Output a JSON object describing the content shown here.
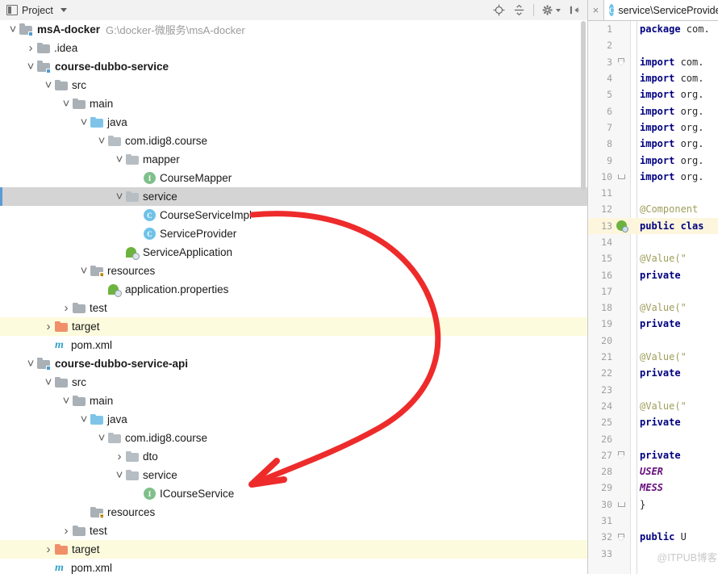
{
  "toolbar": {
    "title": "Project",
    "dropdown_caret": "chevron-down",
    "icons": [
      {
        "name": "locate-icon",
        "glyph": "target"
      },
      {
        "name": "collapse-all-icon",
        "glyph": "collapse"
      },
      {
        "name": "settings-icon",
        "glyph": "gear"
      },
      {
        "name": "hide-panel-icon",
        "glyph": "hide"
      }
    ]
  },
  "tree": {
    "rows": [
      {
        "indent": 0,
        "arrow": "v",
        "icon": "module-folder",
        "label": "msA-docker",
        "bold": true,
        "path": "G:\\docker-微服务\\msA-docker",
        "state": "normal"
      },
      {
        "indent": 1,
        "arrow": ">",
        "icon": "folder-gray",
        "label": ".idea",
        "bold": false,
        "path": "",
        "state": "normal"
      },
      {
        "indent": 1,
        "arrow": "v",
        "icon": "module-folder",
        "label": "course-dubbo-service",
        "bold": true,
        "path": "",
        "state": "normal"
      },
      {
        "indent": 2,
        "arrow": "v",
        "icon": "folder-gray",
        "label": "src",
        "bold": false,
        "path": "",
        "state": "normal"
      },
      {
        "indent": 3,
        "arrow": "v",
        "icon": "folder-gray",
        "label": "main",
        "bold": false,
        "path": "",
        "state": "normal"
      },
      {
        "indent": 4,
        "arrow": "v",
        "icon": "folder-blue",
        "label": "java",
        "bold": false,
        "path": "",
        "state": "normal"
      },
      {
        "indent": 5,
        "arrow": "v",
        "icon": "folder-package",
        "label": "com.idig8.course",
        "bold": false,
        "path": "",
        "state": "normal"
      },
      {
        "indent": 6,
        "arrow": "v",
        "icon": "folder-package",
        "label": "mapper",
        "bold": false,
        "path": "",
        "state": "normal"
      },
      {
        "indent": 7,
        "arrow": "",
        "icon": "interface-icon",
        "label": "CourseMapper",
        "bold": false,
        "path": "",
        "state": "normal"
      },
      {
        "indent": 6,
        "arrow": "v",
        "icon": "folder-package",
        "label": "service",
        "bold": false,
        "path": "",
        "state": "selected"
      },
      {
        "indent": 7,
        "arrow": "",
        "icon": "class-icon",
        "label": "CourseServiceImpl",
        "bold": false,
        "path": "",
        "state": "normal"
      },
      {
        "indent": 7,
        "arrow": "",
        "icon": "class-icon",
        "label": "ServiceProvider",
        "bold": false,
        "path": "",
        "state": "normal"
      },
      {
        "indent": 6,
        "arrow": "",
        "icon": "springboot-icon",
        "label": "ServiceApplication",
        "bold": false,
        "path": "",
        "state": "normal"
      },
      {
        "indent": 4,
        "arrow": "v",
        "icon": "folder-resources",
        "label": "resources",
        "bold": false,
        "path": "",
        "state": "normal"
      },
      {
        "indent": 5,
        "arrow": "",
        "icon": "springboot-icon",
        "label": "application.properties",
        "bold": false,
        "path": "",
        "state": "normal"
      },
      {
        "indent": 3,
        "arrow": ">",
        "icon": "folder-gray",
        "label": "test",
        "bold": false,
        "path": "",
        "state": "normal"
      },
      {
        "indent": 2,
        "arrow": ">",
        "icon": "folder-orange",
        "label": "target",
        "bold": false,
        "path": "",
        "state": "excluded"
      },
      {
        "indent": 2,
        "arrow": "",
        "icon": "maven-file-icon",
        "label": "pom.xml",
        "bold": false,
        "path": "",
        "state": "normal"
      },
      {
        "indent": 1,
        "arrow": "v",
        "icon": "module-folder",
        "label": "course-dubbo-service-api",
        "bold": true,
        "path": "",
        "state": "normal"
      },
      {
        "indent": 2,
        "arrow": "v",
        "icon": "folder-gray",
        "label": "src",
        "bold": false,
        "path": "",
        "state": "normal"
      },
      {
        "indent": 3,
        "arrow": "v",
        "icon": "folder-gray",
        "label": "main",
        "bold": false,
        "path": "",
        "state": "normal"
      },
      {
        "indent": 4,
        "arrow": "v",
        "icon": "folder-blue",
        "label": "java",
        "bold": false,
        "path": "",
        "state": "normal"
      },
      {
        "indent": 5,
        "arrow": "v",
        "icon": "folder-package",
        "label": "com.idig8.course",
        "bold": false,
        "path": "",
        "state": "normal"
      },
      {
        "indent": 6,
        "arrow": ">",
        "icon": "folder-package",
        "label": "dto",
        "bold": false,
        "path": "",
        "state": "normal"
      },
      {
        "indent": 6,
        "arrow": "v",
        "icon": "folder-package",
        "label": "service",
        "bold": false,
        "path": "",
        "state": "normal"
      },
      {
        "indent": 7,
        "arrow": "",
        "icon": "interface-icon",
        "label": "ICourseService",
        "bold": false,
        "path": "",
        "state": "normal"
      },
      {
        "indent": 4,
        "arrow": "",
        "icon": "folder-resources",
        "label": "resources",
        "bold": false,
        "path": "",
        "state": "normal"
      },
      {
        "indent": 3,
        "arrow": ">",
        "icon": "folder-gray",
        "label": "test",
        "bold": false,
        "path": "",
        "state": "normal"
      },
      {
        "indent": 2,
        "arrow": ">",
        "icon": "folder-orange",
        "label": "target",
        "bold": false,
        "path": "",
        "state": "excluded"
      },
      {
        "indent": 2,
        "arrow": "",
        "icon": "maven-file-icon",
        "label": "pom.xml",
        "bold": false,
        "path": "",
        "state": "normal"
      }
    ]
  },
  "editor": {
    "tab": {
      "label": "service\\ServiceProvider",
      "icon": "class-icon",
      "close_glyph": "×"
    },
    "watermark": "@ITPUB博客",
    "lines": [
      {
        "n": "1",
        "gutter": "",
        "hl": false,
        "tokens": [
          {
            "t": "package",
            "c": "kw"
          },
          {
            "t": " com.",
            "c": "plain"
          }
        ]
      },
      {
        "n": "2",
        "gutter": "",
        "hl": false,
        "tokens": []
      },
      {
        "n": "3",
        "gutter": "fold-open",
        "hl": false,
        "tokens": [
          {
            "t": "import",
            "c": "kw"
          },
          {
            "t": " com.",
            "c": "plain"
          }
        ]
      },
      {
        "n": "4",
        "gutter": "",
        "hl": false,
        "tokens": [
          {
            "t": "import",
            "c": "kw"
          },
          {
            "t": " com.",
            "c": "plain"
          }
        ]
      },
      {
        "n": "5",
        "gutter": "",
        "hl": false,
        "tokens": [
          {
            "t": "import",
            "c": "kw"
          },
          {
            "t": " org.",
            "c": "plain"
          }
        ]
      },
      {
        "n": "6",
        "gutter": "",
        "hl": false,
        "tokens": [
          {
            "t": "import",
            "c": "kw"
          },
          {
            "t": " org.",
            "c": "plain"
          }
        ]
      },
      {
        "n": "7",
        "gutter": "",
        "hl": false,
        "tokens": [
          {
            "t": "import",
            "c": "kw"
          },
          {
            "t": " org.",
            "c": "plain"
          }
        ]
      },
      {
        "n": "8",
        "gutter": "",
        "hl": false,
        "tokens": [
          {
            "t": "import",
            "c": "kw"
          },
          {
            "t": " org.",
            "c": "plain"
          }
        ]
      },
      {
        "n": "9",
        "gutter": "",
        "hl": false,
        "tokens": [
          {
            "t": "import",
            "c": "kw"
          },
          {
            "t": " org.",
            "c": "plain"
          }
        ]
      },
      {
        "n": "10",
        "gutter": "fold-end",
        "hl": false,
        "tokens": [
          {
            "t": "import",
            "c": "kw"
          },
          {
            "t": " org.",
            "c": "plain"
          }
        ]
      },
      {
        "n": "11",
        "gutter": "",
        "hl": false,
        "tokens": []
      },
      {
        "n": "12",
        "gutter": "",
        "hl": false,
        "tokens": [
          {
            "t": "@Component",
            "c": "ann"
          }
        ]
      },
      {
        "n": "13",
        "gutter": "bean",
        "hl": true,
        "tokens": [
          {
            "t": "public",
            "c": "kw"
          },
          {
            "t": " clas",
            "c": "kw"
          }
        ]
      },
      {
        "n": "14",
        "gutter": "",
        "hl": false,
        "tokens": []
      },
      {
        "n": "15",
        "gutter": "",
        "hl": false,
        "tokens": [
          {
            "t": "    @Value(\"",
            "c": "ann"
          }
        ]
      },
      {
        "n": "16",
        "gutter": "",
        "hl": false,
        "tokens": [
          {
            "t": "    private",
            "c": "kw"
          }
        ]
      },
      {
        "n": "17",
        "gutter": "",
        "hl": false,
        "tokens": []
      },
      {
        "n": "18",
        "gutter": "",
        "hl": false,
        "tokens": [
          {
            "t": "    @Value(\"",
            "c": "ann"
          }
        ]
      },
      {
        "n": "19",
        "gutter": "",
        "hl": false,
        "tokens": [
          {
            "t": "    private",
            "c": "kw"
          }
        ]
      },
      {
        "n": "20",
        "gutter": "",
        "hl": false,
        "tokens": []
      },
      {
        "n": "21",
        "gutter": "",
        "hl": false,
        "tokens": [
          {
            "t": "    @Value(\"",
            "c": "ann"
          }
        ]
      },
      {
        "n": "22",
        "gutter": "",
        "hl": false,
        "tokens": [
          {
            "t": "    private",
            "c": "kw"
          }
        ]
      },
      {
        "n": "23",
        "gutter": "",
        "hl": false,
        "tokens": []
      },
      {
        "n": "24",
        "gutter": "",
        "hl": false,
        "tokens": [
          {
            "t": "    @Value(\"",
            "c": "ann"
          }
        ]
      },
      {
        "n": "25",
        "gutter": "",
        "hl": false,
        "tokens": [
          {
            "t": "    private",
            "c": "kw"
          }
        ]
      },
      {
        "n": "26",
        "gutter": "",
        "hl": false,
        "tokens": []
      },
      {
        "n": "27",
        "gutter": "fold-open",
        "hl": false,
        "tokens": [
          {
            "t": "    private",
            "c": "kw"
          }
        ]
      },
      {
        "n": "28",
        "gutter": "",
        "hl": false,
        "tokens": [
          {
            "t": "        USER",
            "c": "field"
          }
        ]
      },
      {
        "n": "29",
        "gutter": "",
        "hl": false,
        "tokens": [
          {
            "t": "        MESS",
            "c": "field"
          }
        ]
      },
      {
        "n": "30",
        "gutter": "fold-end",
        "hl": false,
        "tokens": [
          {
            "t": "    }",
            "c": "plain"
          }
        ]
      },
      {
        "n": "31",
        "gutter": "",
        "hl": false,
        "tokens": []
      },
      {
        "n": "32",
        "gutter": "fold-open",
        "hl": false,
        "tokens": [
          {
            "t": "    public",
            "c": "kw"
          },
          {
            "t": " U",
            "c": "plain"
          }
        ]
      },
      {
        "n": "33",
        "gutter": "",
        "hl": false,
        "tokens": []
      }
    ]
  },
  "annotation": {
    "type": "red-arrow",
    "color": "#ee2b2b",
    "from_label": "CourseServiceImpl",
    "to_label": "ICourseService"
  },
  "colors": {
    "selection": "#d4d4d4",
    "selection_accent": "#5a9ad6",
    "excluded_row": "#fdfbdd",
    "keyword": "#000080",
    "annotation_text": "#9e9e5c",
    "field": "#660e7a",
    "arrow_red": "#ee2b2b"
  }
}
